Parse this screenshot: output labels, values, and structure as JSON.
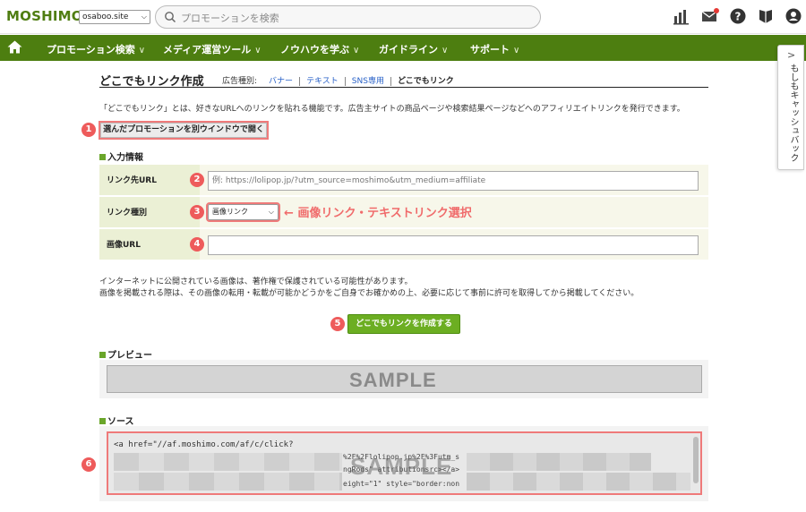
{
  "header": {
    "logo": "MOSHIMO",
    "site_select": "osaboo.site",
    "search_placeholder": "プロモーションを検索"
  },
  "nav": {
    "items": [
      "プロモーション検索",
      "メディア運営ツール",
      "ノウハウを学ぶ",
      "ガイドライン",
      "サポート"
    ]
  },
  "sidetab": {
    "label": "もしもキャッシュバック"
  },
  "page": {
    "title": "どこでもリンク作成",
    "type_label": "広告種別:",
    "types": [
      "バナー",
      "テキスト",
      "SNS専用",
      "どこでもリンク"
    ],
    "intro": "「どこでもリンク」とは、好きなURLへのリンクを貼れる機能です。広告主サイトの商品ページや検索結果ページなどへのアフィリエイトリンクを発行できます。",
    "open_button": "選んだプロモーションを別ウインドウで開く",
    "input_section": "入力情報",
    "link_url_label": "リンク先URL",
    "link_url_placeholder": "例: https://lolipop.jp/?utm_source=moshimo&utm_medium=affiliate",
    "link_type_label": "リンク種別",
    "link_type_value": "画像リンク",
    "link_type_annotation": "画像リンク・テキストリンク選択",
    "image_url_label": "画像URL",
    "notice_1": "インターネットに公開されている画像は、著作権で保護されている可能性があります。",
    "notice_2": "画像を掲載される際は、その画像の転用・転載が可能かどうかをご自身でお確かめの上、必要に応じて事前に許可を取得してから掲載してください。",
    "create_button": "どこでもリンクを作成する",
    "preview_section": "プレビュー",
    "preview_sample": "SAMPLE",
    "source_section": "ソース",
    "source_code": "<a href=\"//af.moshimo.com/af/c/click?",
    "source_frag_1": "%2F%2Flolipop.jp%2F%3Futm_s",
    "source_frag_2": "ngRods\" attributionsrc></a>",
    "source_frag_3": "eight=\"1\" style=\"border:non",
    "source_sample": "SAMPLE"
  },
  "badges": [
    "1",
    "2",
    "3",
    "4",
    "5",
    "6"
  ],
  "colors": {
    "brand_green": "#4d7e10",
    "button_green": "#6cae22",
    "annotation_red": "#f06b6b"
  }
}
